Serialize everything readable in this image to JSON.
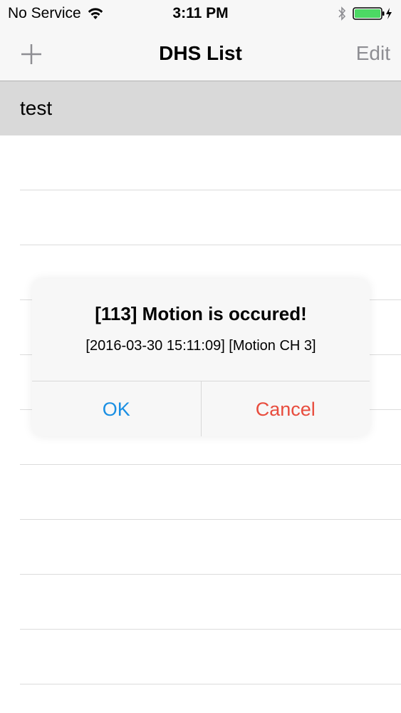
{
  "status_bar": {
    "carrier": "No Service",
    "time": "3:11 PM",
    "wifi_icon": "wifi-icon",
    "bluetooth_icon": "bluetooth-icon",
    "battery_icon": "battery-icon",
    "battery_level": 1.0,
    "battery_color": "#4cd964"
  },
  "nav": {
    "add_icon": "plus-icon",
    "title": "DHS List",
    "edit_label": "Edit"
  },
  "list": {
    "items": [
      {
        "label": "test",
        "selected": true
      },
      {
        "label": ""
      },
      {
        "label": ""
      },
      {
        "label": ""
      },
      {
        "label": ""
      },
      {
        "label": ""
      },
      {
        "label": ""
      },
      {
        "label": ""
      },
      {
        "label": ""
      },
      {
        "label": ""
      },
      {
        "label": ""
      },
      {
        "label": ""
      }
    ]
  },
  "alert": {
    "title": "[113] Motion is occured!",
    "message": "[2016-03-30 15:11:09] [Motion CH 3]",
    "ok_label": "OK",
    "cancel_label": "Cancel",
    "ok_color": "#1a8fe3",
    "cancel_color": "#e84c3d"
  }
}
